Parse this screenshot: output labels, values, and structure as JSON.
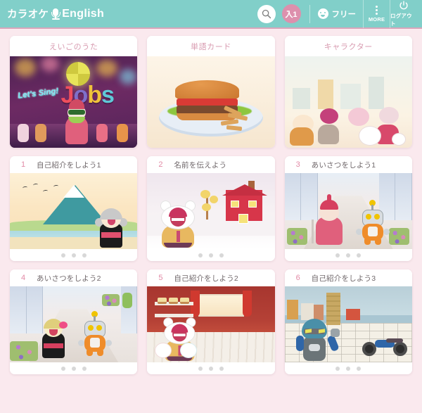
{
  "header": {
    "brand_jp": "カラオケ",
    "brand_en": "English",
    "mic_icon": "microphone-icon",
    "search_icon": "search-icon",
    "user_badge": "入1",
    "plan_label": "フリー",
    "plan_icon": "face-icon",
    "more_label": "MORE",
    "more_icon": "vertical-dots-icon",
    "logout_label": "ログアウト",
    "logout_icon": "power-icon",
    "bg_color": "#81cfc9",
    "accent_color": "#dd90ad",
    "underline_color": "#d9a6bb"
  },
  "page": {
    "background_color": "#fae9ee",
    "card_background": "#ffffff",
    "title_color": "#d89bb0",
    "number_color": "#e28aa6",
    "lesson_title_color": "#70686b"
  },
  "feature_cards": [
    {
      "title": "えいごのうた",
      "art": "lets-sing-jobs-stage",
      "song_title": "Let's Sing!",
      "song_word": "Jobs"
    },
    {
      "title": "単語カード",
      "art": "hamburger-plate"
    },
    {
      "title": "キャラクター",
      "art": "character-group"
    }
  ],
  "lesson_cards": [
    {
      "number": "1",
      "title": "自己紹介をしよう1",
      "art": "mount-fuji-kimono-girl",
      "dots": 3
    },
    {
      "number": "2",
      "title": "名前を伝えよう",
      "art": "snow-red-house-bear",
      "dots": 3
    },
    {
      "number": "3",
      "title": "あいさつをしよう1",
      "art": "shopping-street-lady-robot",
      "dots": 3
    },
    {
      "number": "4",
      "title": "あいさつをしよう2",
      "art": "shopping-street-geisha-robot",
      "dots": 3
    },
    {
      "number": "5",
      "title": "自己紹介をしよう2",
      "art": "cafe-bear-kittens",
      "dots": 3
    },
    {
      "number": "6",
      "title": "自己紹介をしよう3",
      "art": "seaside-hero-motorbike",
      "dots": 3
    }
  ]
}
